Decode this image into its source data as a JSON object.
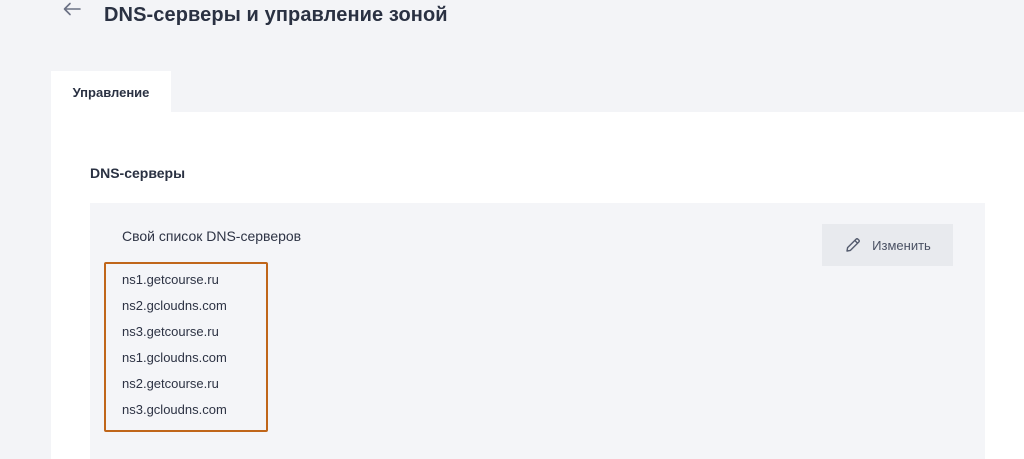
{
  "header": {
    "back_icon": "arrow-left-icon",
    "title": "DNS-серверы и управление зоной"
  },
  "tabs": [
    {
      "label": "Управление",
      "active": true
    }
  ],
  "main": {
    "section_title": "DNS-серверы",
    "card": {
      "label": "Свой список DNS-серверов",
      "edit_button": {
        "label": "Изменить",
        "icon": "pencil-icon"
      },
      "servers": [
        "ns1.getcourse.ru",
        "ns2.gcloudns.com",
        "ns3.getcourse.ru",
        "ns1.gcloudns.com",
        "ns2.getcourse.ru",
        "ns3.gcloudns.com"
      ]
    }
  },
  "colors": {
    "background": "#f3f4f7",
    "panel": "#ffffff",
    "card": "#f4f5f8",
    "highlight_border": "#c0661a",
    "title_text": "#2a3142"
  }
}
